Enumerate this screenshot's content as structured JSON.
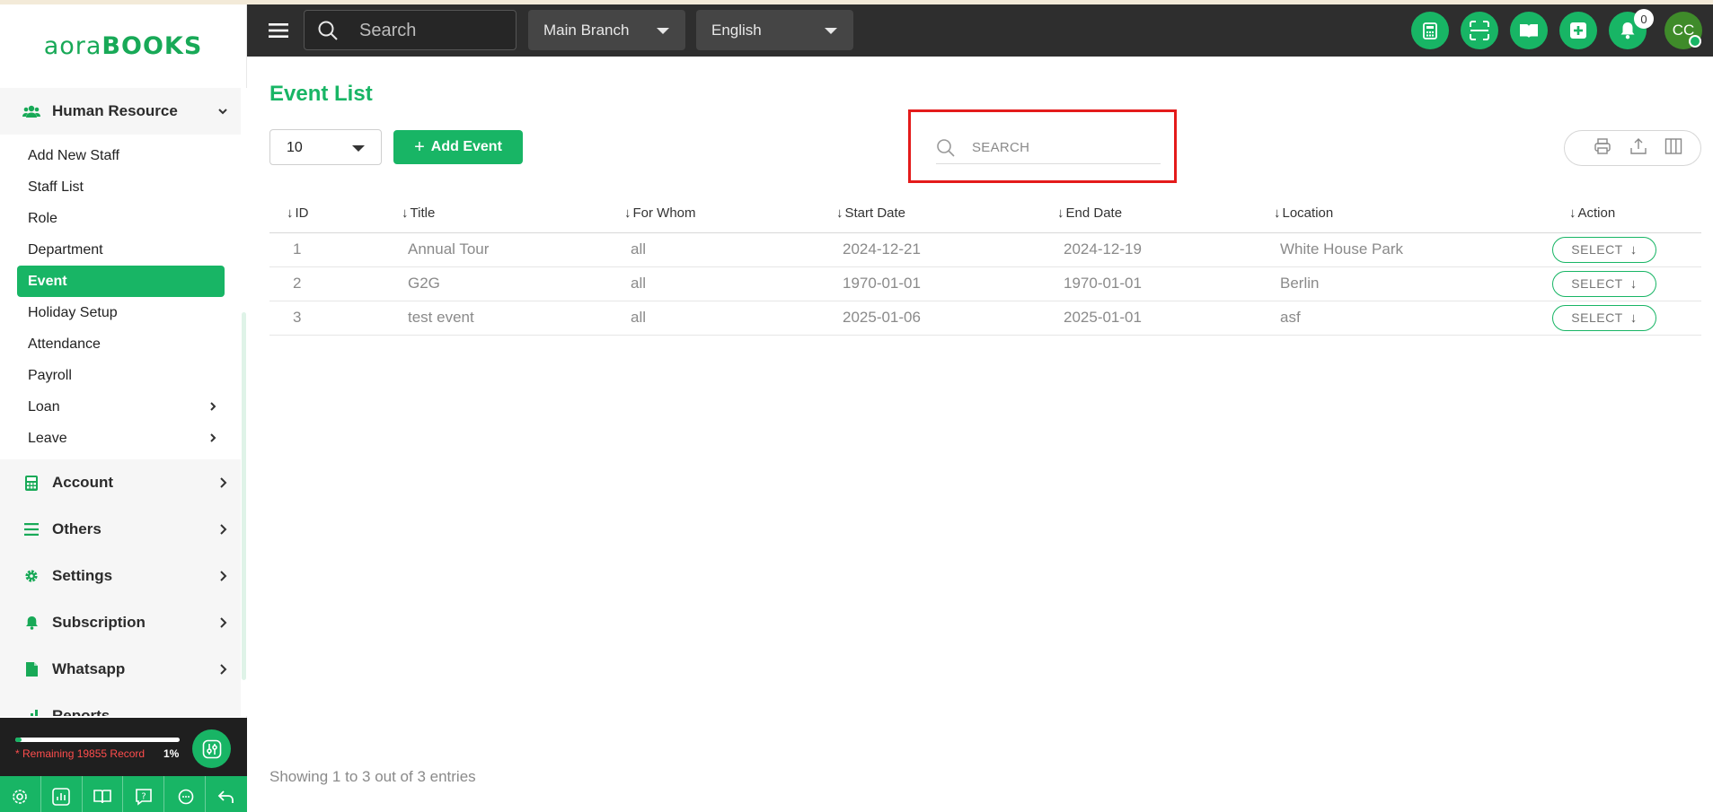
{
  "app": {
    "logo_left": "aora",
    "logo_right": "BOOKS"
  },
  "colors": {
    "brand": "#18b565",
    "header_bg": "#2e2e2e",
    "highlight": "#e41b1b"
  },
  "header": {
    "search_placeholder": "Search",
    "branch": "Main Branch",
    "language": "English",
    "notifications_count": "0",
    "avatar_initials": "CC",
    "icons": [
      "calculator-icon",
      "scan-icon",
      "book-icon",
      "plus-square-icon",
      "bell-icon"
    ]
  },
  "sidebar": {
    "group_hr": "Human Resource",
    "hr_items": [
      {
        "label": "Add New Staff"
      },
      {
        "label": "Staff List"
      },
      {
        "label": "Role"
      },
      {
        "label": "Department"
      },
      {
        "label": "Event",
        "active": true
      },
      {
        "label": "Holiday Setup"
      },
      {
        "label": "Attendance"
      },
      {
        "label": "Payroll"
      },
      {
        "label": "Loan",
        "submenu": true
      },
      {
        "label": "Leave",
        "submenu": true
      }
    ],
    "groups": [
      {
        "label": "Account",
        "icon": "calculator-icon"
      },
      {
        "label": "Others",
        "icon": "list-icon"
      },
      {
        "label": "Settings",
        "icon": "gear-icon"
      },
      {
        "label": "Subscription",
        "icon": "bell-icon"
      },
      {
        "label": "Whatsapp",
        "icon": "document-icon"
      },
      {
        "label": "Reports",
        "icon": "bar-chart-icon"
      }
    ],
    "usage": {
      "text": "* Remaining 19855 Record",
      "percent_label": "1%",
      "percent": 1
    },
    "bottom_tools": [
      "gear-icon",
      "chart-icon",
      "book-icon",
      "help-icon",
      "chat-icon",
      "logout-icon"
    ]
  },
  "main": {
    "title": "Event List",
    "page_size": "10",
    "add_label": "Add Event",
    "search_placeholder": "SEARCH",
    "columns": [
      "ID",
      "Title",
      "For Whom",
      "Start Date",
      "End Date",
      "Location",
      "Action"
    ],
    "rows": [
      {
        "id": "1",
        "title": "Annual Tour",
        "for_whom": "all",
        "start": "2024-12-21",
        "end": "2024-12-19",
        "location": "White House Park",
        "action": "SELECT"
      },
      {
        "id": "2",
        "title": "G2G",
        "for_whom": "all",
        "start": "1970-01-01",
        "end": "1970-01-01",
        "location": "Berlin",
        "action": "SELECT"
      },
      {
        "id": "3",
        "title": "test event",
        "for_whom": "all",
        "start": "2025-01-06",
        "end": "2025-01-01",
        "location": "asf",
        "action": "SELECT"
      }
    ],
    "footer": "Showing 1 to 3 out of 3 entries"
  }
}
